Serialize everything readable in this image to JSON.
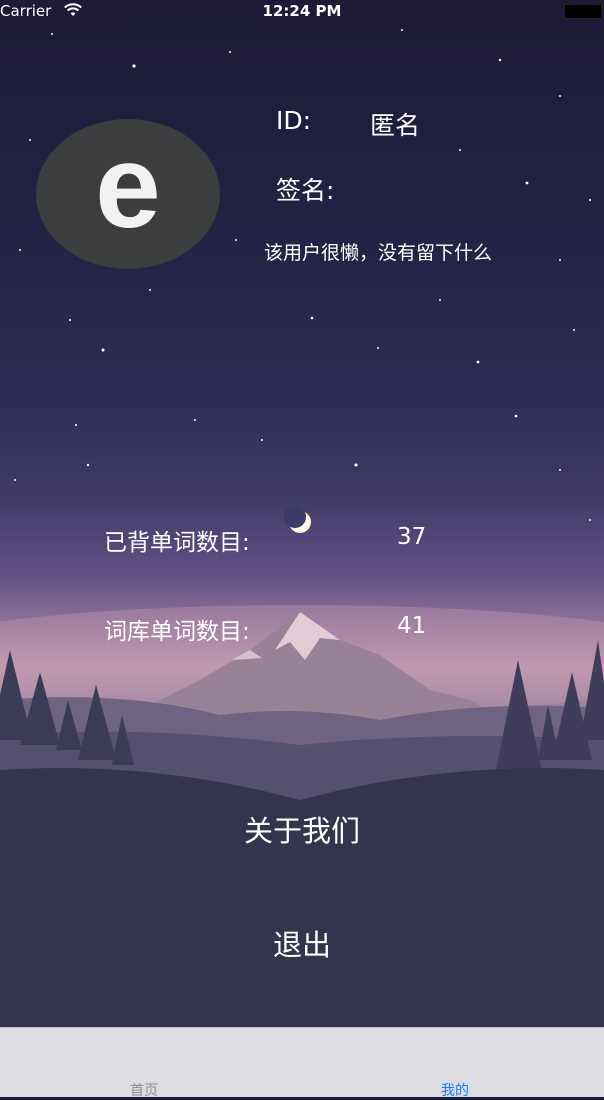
{
  "status_bar": {
    "carrier": "Carrier",
    "time": "12:24 PM"
  },
  "profile": {
    "avatar_letter": "e",
    "id_label": "ID:",
    "id_value": "匿名",
    "signature_label": "签名:",
    "signature_value": "该用户很懒，没有留下什么"
  },
  "stats": {
    "learned_label": "已背单词数目:",
    "learned_value": "37",
    "library_label": "词库单词数目:",
    "library_value": "41"
  },
  "actions": {
    "about_label": "关于我们",
    "logout_label": "退出"
  },
  "tabbar": {
    "items": [
      {
        "label": "首页",
        "selected": false
      },
      {
        "label": "我的",
        "selected": true
      }
    ],
    "selected_color": "#1a7cf5",
    "unselected_color": "#8e8e93"
  },
  "icons": {
    "wifi": "wifi-icon",
    "battery": "battery-icon",
    "moon": "crescent-moon-icon"
  }
}
